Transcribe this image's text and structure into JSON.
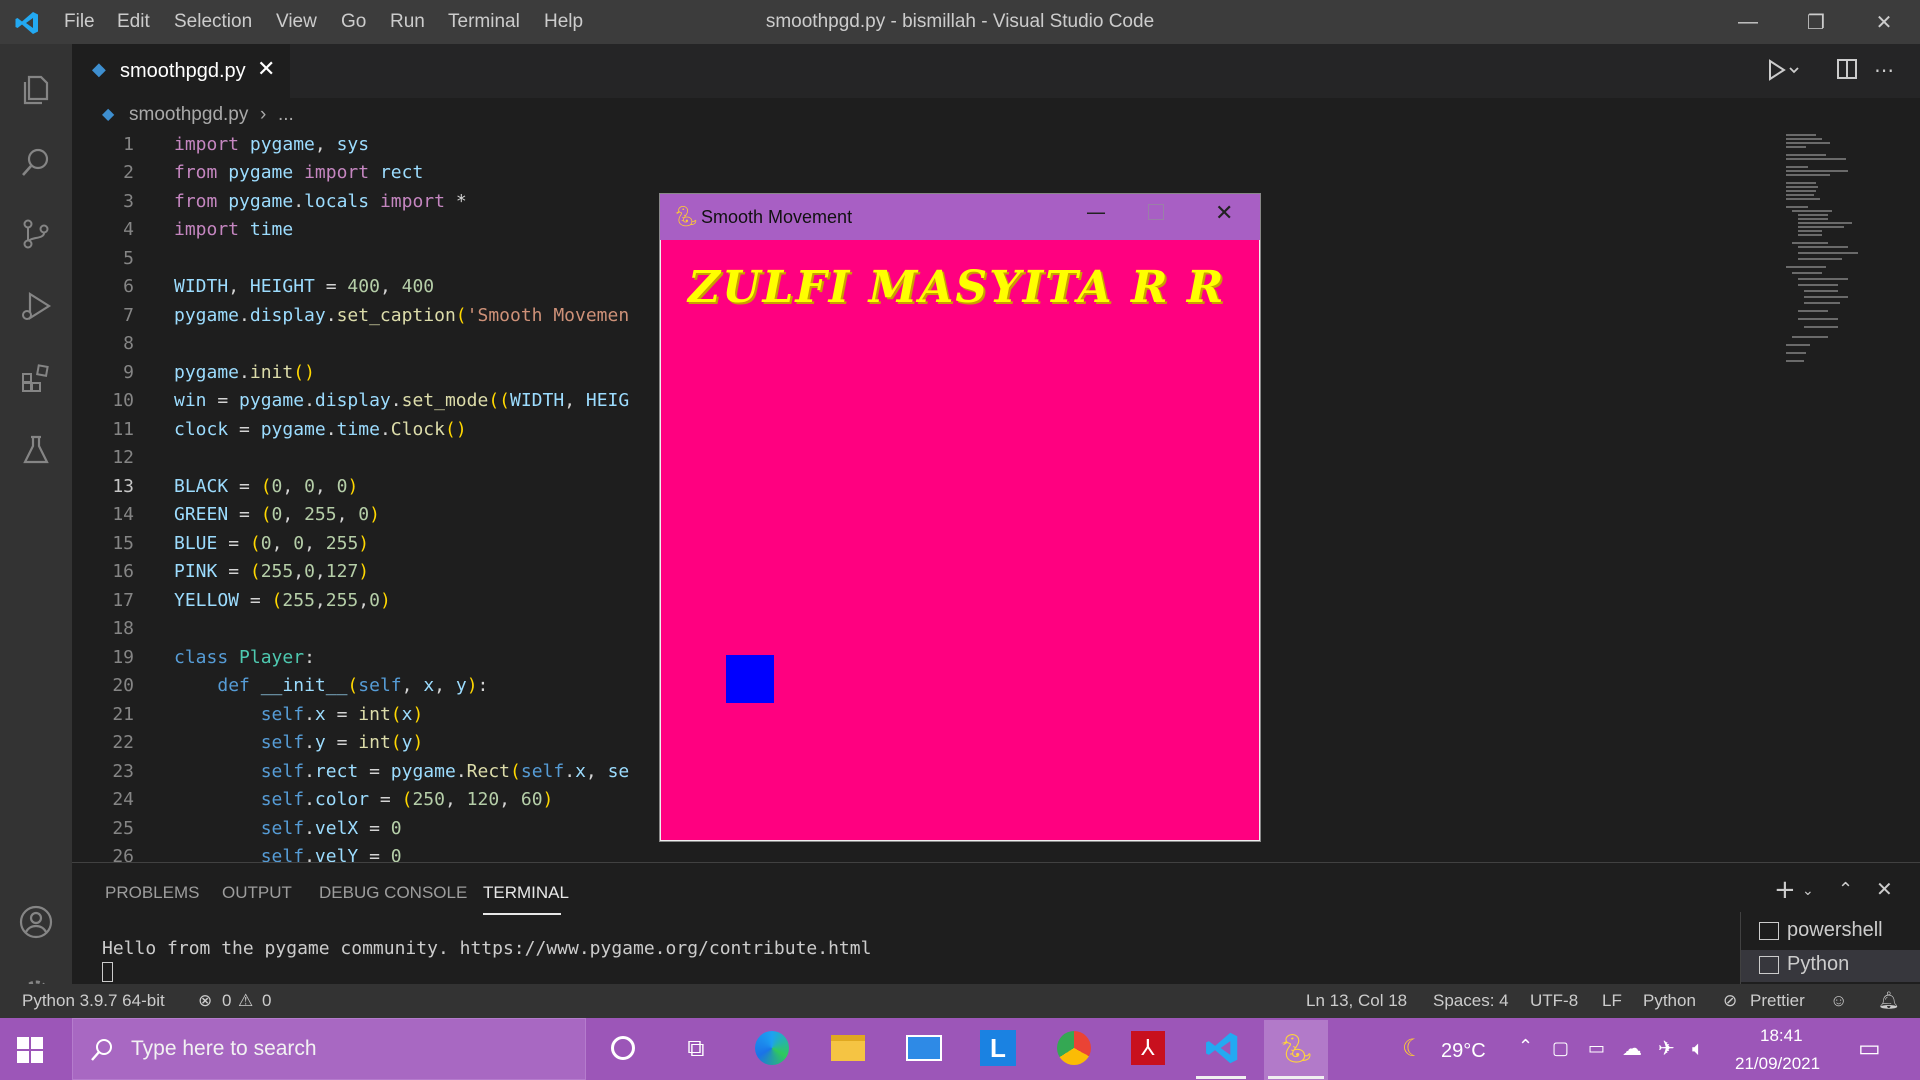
{
  "titlebar": {
    "menu": [
      "File",
      "Edit",
      "Selection",
      "View",
      "Go",
      "Run",
      "Terminal",
      "Help"
    ],
    "title": "smoothpgd.py - bismillah - Visual Studio Code"
  },
  "tab": {
    "label": "smoothpgd.py"
  },
  "breadcrumb": {
    "file": "smoothpgd.py",
    "rest": "..."
  },
  "editor": {
    "line_numbers": [
      "1",
      "2",
      "3",
      "4",
      "5",
      "6",
      "7",
      "8",
      "9",
      "10",
      "11",
      "12",
      "13",
      "14",
      "15",
      "16",
      "17",
      "18",
      "19",
      "20",
      "21",
      "22",
      "23",
      "24",
      "25",
      "26"
    ],
    "lines": [
      "import pygame, sys",
      "from pygame import rect",
      "from pygame.locals import *",
      "import time",
      "",
      "WIDTH, HEIGHT = 400, 400",
      "pygame.display.set_caption('Smooth Movemen",
      "",
      "pygame.init()",
      "win = pygame.display.set_mode((WIDTH, HEIG",
      "clock = pygame.time.Clock()",
      "",
      "BLACK = (0, 0, 0)",
      "GREEN = (0, 255, 0)",
      "BLUE = (0, 0, 255)",
      "PINK = (255,0,127)",
      "YELLOW = (255,255,0)",
      "",
      "class Player:",
      "    def __init__(self, x, y):",
      "        self.x = int(x)",
      "        self.y = int(y)",
      "        self.rect = pygame.Rect(self.x, se",
      "        self.color = (250, 120, 60)",
      "        self.velX = 0",
      "        self.velY = 0"
    ],
    "current_line": "13"
  },
  "panel": {
    "tabs": [
      "PROBLEMS",
      "OUTPUT",
      "DEBUG CONSOLE",
      "TERMINAL"
    ],
    "active_tab": "TERMINAL",
    "terminal_output": "Hello from the pygame community. https://www.pygame.org/contribute.html",
    "terminals": [
      "powershell",
      "Python"
    ]
  },
  "statusbar": {
    "interpreter": "Python 3.9.7 64-bit",
    "errors": "0",
    "warnings": "0",
    "position": "Ln 13, Col 18",
    "spaces": "Spaces: 4",
    "encoding": "UTF-8",
    "eol": "LF",
    "language": "Python",
    "formatter": "Prettier"
  },
  "pygame_window": {
    "title": "Smooth Movement",
    "heading": "ZULFI MASYITA R R",
    "background_color": "#ff0080",
    "player_color": "#0000ff"
  },
  "taskbar": {
    "search_placeholder": "Type here to search",
    "weather": "29°C",
    "time": "18:41",
    "date": "21/09/2021"
  },
  "colors": {
    "titlebar": "#3c3c3c",
    "editor_bg": "#1e1e1e",
    "taskbar": "#9c56b8"
  }
}
